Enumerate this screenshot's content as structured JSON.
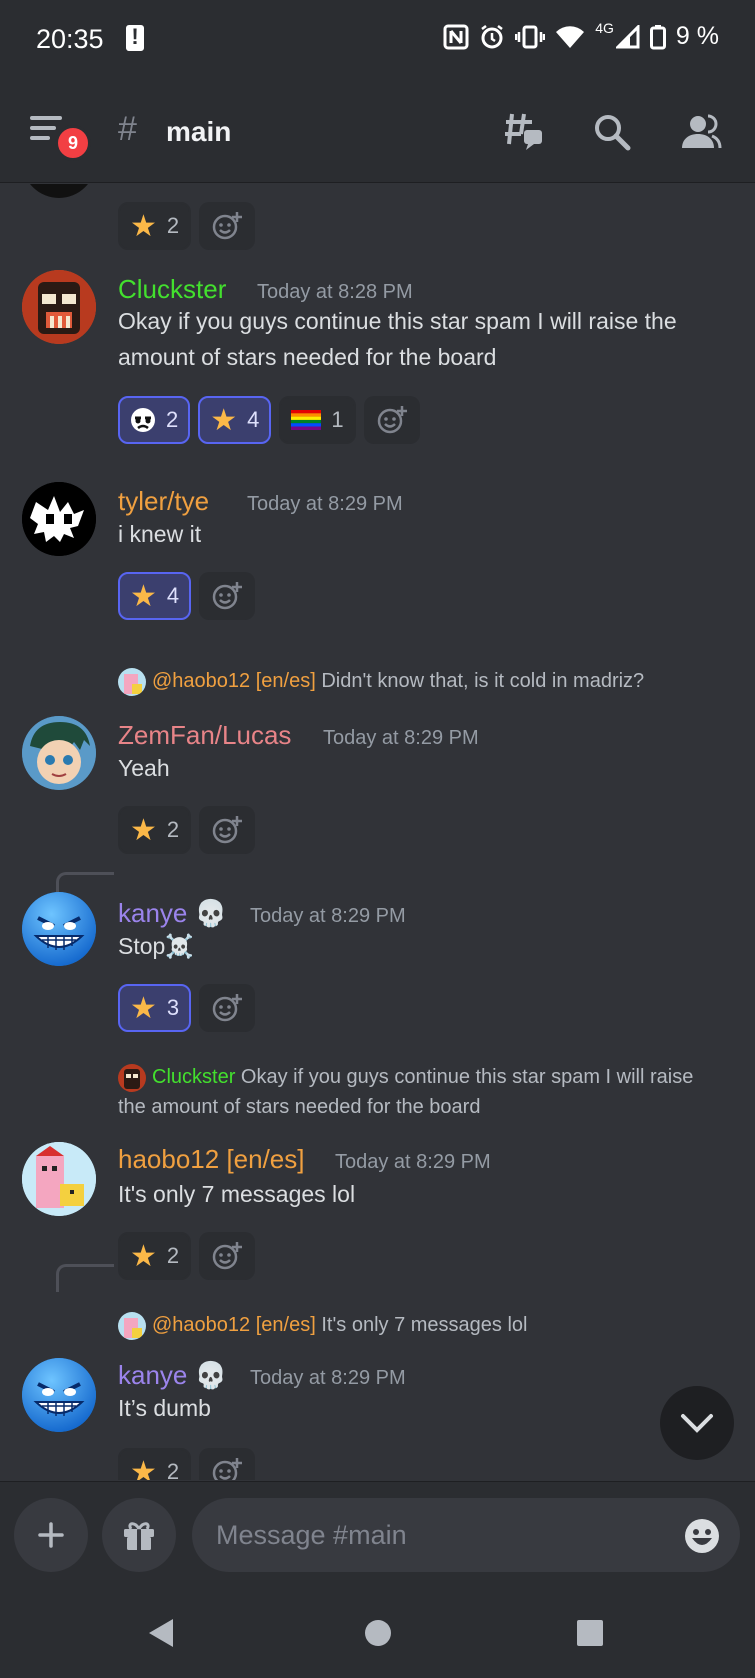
{
  "status_bar": {
    "time": "20:35",
    "network": "4G",
    "battery": "9 %",
    "icons": [
      "alert-icon",
      "nfc-icon",
      "alarm-icon",
      "vibrate-icon",
      "wifi-icon",
      "signal-icon",
      "battery-icon"
    ]
  },
  "header": {
    "badge_count": "9",
    "channel_hash": "#",
    "channel_name": "main"
  },
  "messages": [
    {
      "reactions": [
        {
          "emoji": "star",
          "count": "2",
          "me": false
        }
      ]
    },
    {
      "username": "Cluckster",
      "timestamp": "Today at 8:28 PM",
      "text": "Okay if you guys continue this star spam I will raise the amount of stars needed for the board",
      "reactions": [
        {
          "emoji": "custom-face",
          "count": "2",
          "me": true
        },
        {
          "emoji": "star",
          "count": "4",
          "me": true
        },
        {
          "emoji": "rainbow-flag",
          "count": "1",
          "me": false
        }
      ]
    },
    {
      "username": "tyler/tye",
      "timestamp": "Today at 8:29 PM",
      "text": "i knew it",
      "reactions": [
        {
          "emoji": "star",
          "count": "4",
          "me": true
        }
      ]
    },
    {
      "reply_name": "@haobo12 [en/es]",
      "reply_text": "Didn't know that, is it cold in madriz?",
      "username": "ZemFan/Lucas",
      "timestamp": "Today at 8:29 PM",
      "text": "Yeah",
      "reactions": [
        {
          "emoji": "star",
          "count": "2",
          "me": false
        }
      ]
    },
    {
      "username": "kanye",
      "username_suffix": "💀",
      "timestamp": "Today at 8:29 PM",
      "text": "Stop",
      "text_suffix": "☠️",
      "reactions": [
        {
          "emoji": "star",
          "count": "3",
          "me": true
        }
      ]
    },
    {
      "reply_name": "Cluckster",
      "reply_text": "Okay if you guys continue this star spam I will raise the amount of stars needed for the board",
      "username": "haobo12 [en/es]",
      "timestamp": "Today at 8:29 PM",
      "text": "It's only 7 messages lol",
      "reactions": [
        {
          "emoji": "star",
          "count": "2",
          "me": false
        }
      ]
    },
    {
      "reply_name": "@haobo12 [en/es]",
      "reply_text": "It's only 7 messages lol",
      "username": "kanye",
      "username_suffix": "💀",
      "timestamp": "Today at 8:29 PM",
      "text": "It’s dumb",
      "reactions": [
        {
          "emoji": "star",
          "count": "2",
          "me": false
        }
      ]
    }
  ],
  "input": {
    "placeholder": "Message #main"
  },
  "colors": {
    "background": "#313338",
    "header": "#2b2d31",
    "accent": "#5865f2",
    "star": "#fbb848"
  }
}
